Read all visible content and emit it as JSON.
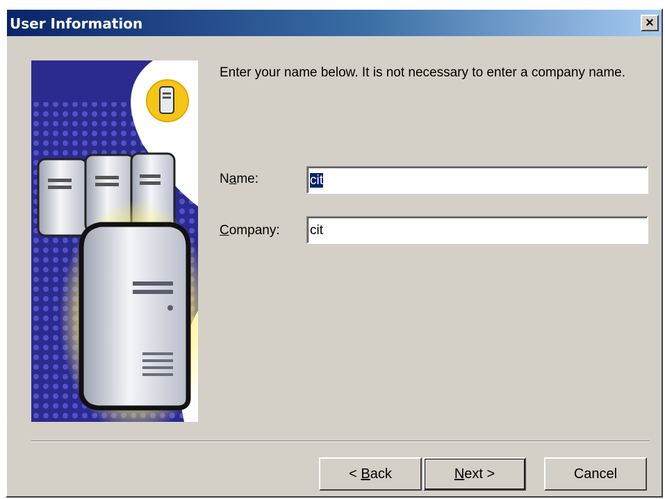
{
  "window": {
    "title": "User Information",
    "close_glyph": "×"
  },
  "prompt": "Enter your name below.  It is not necessary to enter a company name.",
  "fields": {
    "name": {
      "label_pre": "N",
      "label_key": "a",
      "label_post": "me:",
      "value": "cit",
      "selected": true
    },
    "company": {
      "label_pre": "",
      "label_key": "C",
      "label_post": "ompany:",
      "value": "cit"
    }
  },
  "buttons": {
    "back": {
      "pre": "< ",
      "key": "B",
      "post": "ack"
    },
    "next": {
      "pre": "",
      "key": "N",
      "post": "ext >"
    },
    "cancel": {
      "label": "Cancel"
    }
  },
  "illustration": {
    "icon": "server-computers-illustration",
    "colors": {
      "background": "#2b2a8f",
      "dots": "#5b57d0",
      "glow": "#fff36a",
      "badge": "#f5c518"
    }
  }
}
